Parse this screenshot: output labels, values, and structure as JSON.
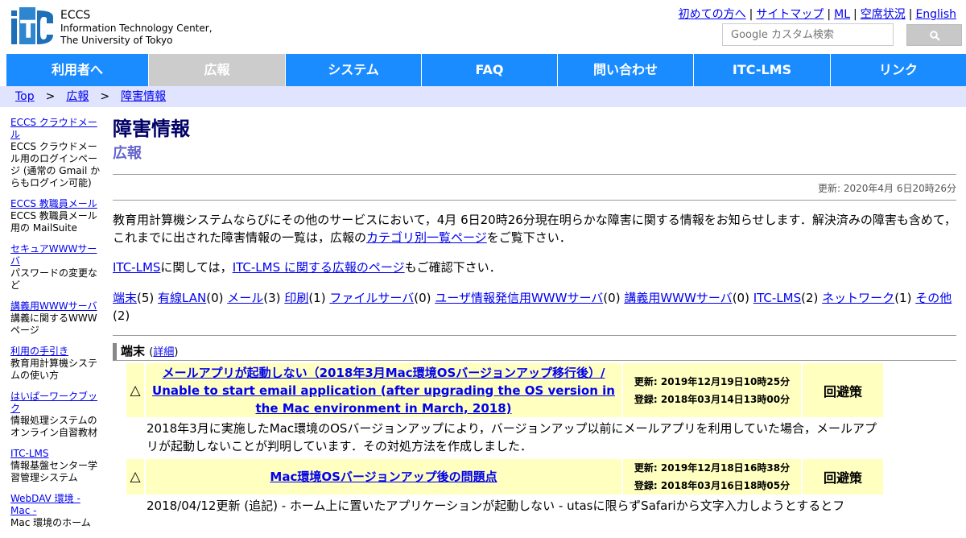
{
  "header": {
    "logo_text": "iTC",
    "org_name": "ECCS",
    "org_line2": "Information Technology Center,",
    "org_line3": "The University of Tokyo",
    "top_links": [
      "初めての方へ",
      "サイトマップ",
      "ML",
      "空席状況",
      "English"
    ],
    "search_placeholder": "Google カスタム検索"
  },
  "nav": {
    "items": [
      "利用者へ",
      "広報",
      "システム",
      "FAQ",
      "問い合わせ",
      "ITC-LMS",
      "リンク"
    ],
    "active_index": 1
  },
  "breadcrumb": [
    "Top",
    "広報",
    "障害情報"
  ],
  "sidebar": [
    {
      "link": "ECCS クラウドメール",
      "desc": "ECCS クラウドメール用のログインページ (通常の Gmail からもログイン可能)"
    },
    {
      "link": "ECCS 教職員メール",
      "desc": "ECCS 教職員メール用の MailSuite"
    },
    {
      "link": "セキュアWWWサーバ",
      "desc": "パスワードの変更など"
    },
    {
      "link": "講義用WWWサーバ",
      "desc": "講義に関するWWWページ"
    },
    {
      "link": "利用の手引き",
      "desc": "教育用計算機システムの使い方"
    },
    {
      "link": "はいぱーワークブック",
      "desc": "情報処理システムのオンライン自習教材"
    },
    {
      "link": "ITC-LMS",
      "desc": "情報基盤センター学習管理システム"
    },
    {
      "link": "WebDAV 環境 - Mac -",
      "desc": "Mac 環境のホーム"
    }
  ],
  "main": {
    "title": "障害情報",
    "subtitle": "広報",
    "updated": "更新: 2020年4月 6日20時26分",
    "intro_1": "教育用計算機システムならびにその他のサービスにおいて，4月 6日20時26分現在明らかな障害に関する情報をお知らせします．解決済みの障害も含めて，これまでに出された障害情報の一覧は，広報の",
    "intro_link": "カテゴリ別一覧ページ",
    "intro_2": "をご覧下さい．",
    "lms_link1": "ITC-LMS",
    "lms_text1": "に関しては，",
    "lms_link2": "ITC-LMS に関する広報のページ",
    "lms_text2": "もご確認下さい．",
    "categories": [
      {
        "name": "端末",
        "count": "(5)"
      },
      {
        "name": "有線LAN",
        "count": "(0)"
      },
      {
        "name": "メール",
        "count": "(3)"
      },
      {
        "name": "印刷",
        "count": "(1)"
      },
      {
        "name": "ファイルサーバ",
        "count": "(0)"
      },
      {
        "name": "ユーザ情報発信用WWWサーバ",
        "count": "(0)"
      },
      {
        "name": "講義用WWWサーバ",
        "count": "(0)"
      },
      {
        "name": "ITC-LMS",
        "count": "(2)"
      },
      {
        "name": "ネットワーク",
        "count": "(1)"
      },
      {
        "name": "その他",
        "count": "(2)"
      }
    ],
    "section_title": "端末",
    "section_detail_open": "(",
    "section_detail_link": "詳細",
    "section_detail_close": ")"
  },
  "incidents": [
    {
      "mark": "△",
      "title": "メールアプリが起動しない（2018年3月Mac環境OSバージョンアップ移行後）/ Unable to start email application (after upgrading the OS version in the Mac environment in March, 2018)",
      "updated": "更新: 2019年12月19日10時25分",
      "registered": "登録: 2018年03月14日13時00分",
      "kind": "回避策",
      "desc": "2018年3月に実施したMac環境のOSバージョンアップにより，バージョンアップ以前にメールアプリを利用していた場合，メールアプリが起動しないことが判明しています．その対処方法を作成しました．"
    },
    {
      "mark": "△",
      "title": "Mac環境OSバージョンアップ後の問題点",
      "updated": "更新: 2019年12月18日16時38分",
      "registered": "登録: 2018年03月16日18時05分",
      "kind": "回避策",
      "desc": "2018/04/12更新 (追記) - ホーム上に置いたアプリケーションが起動しない - utasに限らずSafariから文字入力しようとするとフ"
    }
  ],
  "colors": {
    "nav_blue": "#1a8cff",
    "nav_active": "#cccccc",
    "breadcrumb_bg": "#e0e4ff",
    "title_navy": "#000066",
    "subtitle_purple": "#6666cc",
    "incident_bg": "#ffffc0"
  }
}
